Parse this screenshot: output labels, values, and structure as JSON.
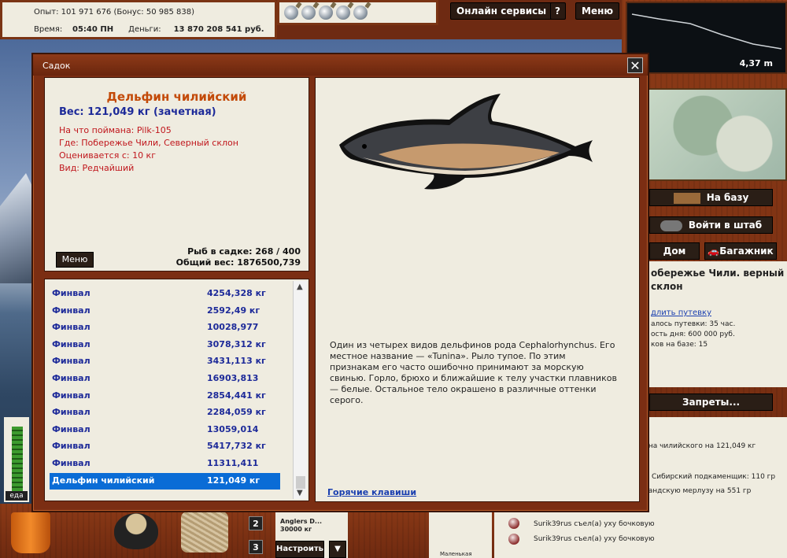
{
  "stats": {
    "experience": "Опыт: 101 971 676 (Бонус: 50 985 838)",
    "time_label": "Время:",
    "time_value": "05:40 ПН",
    "money_label": "Деньги:",
    "money_value": "13 870 208 541 руб."
  },
  "toolbar": {
    "online_services": "Онлайн сервисы",
    "help": "?",
    "menu": "Меню"
  },
  "depth": {
    "value": "4,37 m"
  },
  "right_panel": {
    "to_base": "На базу",
    "join_hq": "Войти в штаб",
    "home": "Дом",
    "trunk": "Багажник",
    "location_title": "обережье Чили. верный склон",
    "extend_link": "длить путевку",
    "details_1": "алось путевки: 35 час.",
    "details_2": "ость дня: 600 000 руб.",
    "details_3": "ков на базе: 15",
    "bans": "Запреты..."
  },
  "chat": {
    "lines": [
      "ина чилийского на 121,049 кг",
      "!",
      "Сибирский подкаменщик: 110 гр",
      "ландскую мерлузу на 551 гр",
      "Surik39rus съел(а) уху бочковую",
      "Surik39rus съел(а) уху бочковую"
    ]
  },
  "bottom": {
    "food_label": "еда",
    "slot_2": "2",
    "slot_3": "3",
    "bait_name": "Anglers D...",
    "bait_price": "30000 кг",
    "configure": "Настроить",
    "dropdown": "▼",
    "lure_name": "Маленькая"
  },
  "dialog": {
    "title": "Садок",
    "close": "✕",
    "fish_name": "Дельфин чилийский",
    "fish_weight": "Вес: 121,049 кг (зачетная)",
    "caught_on": "На что поймана: Pilk-105",
    "location": "Где: Побережье Чили, Северный склон",
    "rated_from": "Оценивается с: 10 кг",
    "rarity": "Вид: Редчайший",
    "menu_button": "Меню",
    "fish_count": "Рыб в садке: 268 / 400",
    "total_weight": "Общий вес: 1876500,739",
    "description": "Один из четырех видов дельфинов рода Cephalorhynchus. Его местное название — «Tunina». Рыло тупое. По этим признакам его часто ошибочно принимают за морскую свинью. Горло, брюхо и ближайшие к телу участки плавников — белые. Остальное тело окрашено в различные оттенки серого.",
    "hotkeys": "Горячие клавиши"
  },
  "fish_list": [
    {
      "name": "Финвал",
      "weight": "4254,328 кг"
    },
    {
      "name": "Финвал",
      "weight": "2592,49 кг"
    },
    {
      "name": "Финвал",
      "weight": "10028,977"
    },
    {
      "name": "Финвал",
      "weight": "3078,312 кг"
    },
    {
      "name": "Финвал",
      "weight": "3431,113 кг"
    },
    {
      "name": "Финвал",
      "weight": "16903,813"
    },
    {
      "name": "Финвал",
      "weight": "2854,441 кг"
    },
    {
      "name": "Финвал",
      "weight": "2284,059 кг"
    },
    {
      "name": "Финвал",
      "weight": "13059,014"
    },
    {
      "name": "Финвал",
      "weight": "5417,732 кг"
    },
    {
      "name": "Финвал",
      "weight": "11311,411"
    },
    {
      "name": "Дельфин чилийский",
      "weight": "121,049 кг"
    }
  ]
}
